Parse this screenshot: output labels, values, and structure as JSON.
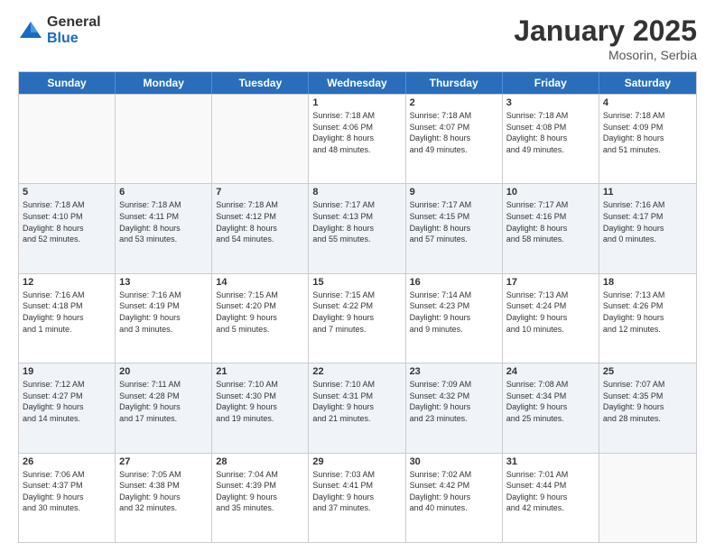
{
  "logo": {
    "general": "General",
    "blue": "Blue"
  },
  "title": {
    "month": "January 2025",
    "location": "Mosorin, Serbia"
  },
  "header_days": [
    "Sunday",
    "Monday",
    "Tuesday",
    "Wednesday",
    "Thursday",
    "Friday",
    "Saturday"
  ],
  "weeks": [
    [
      {
        "day": "",
        "text": ""
      },
      {
        "day": "",
        "text": ""
      },
      {
        "day": "",
        "text": ""
      },
      {
        "day": "1",
        "text": "Sunrise: 7:18 AM\nSunset: 4:06 PM\nDaylight: 8 hours\nand 48 minutes."
      },
      {
        "day": "2",
        "text": "Sunrise: 7:18 AM\nSunset: 4:07 PM\nDaylight: 8 hours\nand 49 minutes."
      },
      {
        "day": "3",
        "text": "Sunrise: 7:18 AM\nSunset: 4:08 PM\nDaylight: 8 hours\nand 49 minutes."
      },
      {
        "day": "4",
        "text": "Sunrise: 7:18 AM\nSunset: 4:09 PM\nDaylight: 8 hours\nand 51 minutes."
      }
    ],
    [
      {
        "day": "5",
        "text": "Sunrise: 7:18 AM\nSunset: 4:10 PM\nDaylight: 8 hours\nand 52 minutes."
      },
      {
        "day": "6",
        "text": "Sunrise: 7:18 AM\nSunset: 4:11 PM\nDaylight: 8 hours\nand 53 minutes."
      },
      {
        "day": "7",
        "text": "Sunrise: 7:18 AM\nSunset: 4:12 PM\nDaylight: 8 hours\nand 54 minutes."
      },
      {
        "day": "8",
        "text": "Sunrise: 7:17 AM\nSunset: 4:13 PM\nDaylight: 8 hours\nand 55 minutes."
      },
      {
        "day": "9",
        "text": "Sunrise: 7:17 AM\nSunset: 4:15 PM\nDaylight: 8 hours\nand 57 minutes."
      },
      {
        "day": "10",
        "text": "Sunrise: 7:17 AM\nSunset: 4:16 PM\nDaylight: 8 hours\nand 58 minutes."
      },
      {
        "day": "11",
        "text": "Sunrise: 7:16 AM\nSunset: 4:17 PM\nDaylight: 9 hours\nand 0 minutes."
      }
    ],
    [
      {
        "day": "12",
        "text": "Sunrise: 7:16 AM\nSunset: 4:18 PM\nDaylight: 9 hours\nand 1 minute."
      },
      {
        "day": "13",
        "text": "Sunrise: 7:16 AM\nSunset: 4:19 PM\nDaylight: 9 hours\nand 3 minutes."
      },
      {
        "day": "14",
        "text": "Sunrise: 7:15 AM\nSunset: 4:20 PM\nDaylight: 9 hours\nand 5 minutes."
      },
      {
        "day": "15",
        "text": "Sunrise: 7:15 AM\nSunset: 4:22 PM\nDaylight: 9 hours\nand 7 minutes."
      },
      {
        "day": "16",
        "text": "Sunrise: 7:14 AM\nSunset: 4:23 PM\nDaylight: 9 hours\nand 9 minutes."
      },
      {
        "day": "17",
        "text": "Sunrise: 7:13 AM\nSunset: 4:24 PM\nDaylight: 9 hours\nand 10 minutes."
      },
      {
        "day": "18",
        "text": "Sunrise: 7:13 AM\nSunset: 4:26 PM\nDaylight: 9 hours\nand 12 minutes."
      }
    ],
    [
      {
        "day": "19",
        "text": "Sunrise: 7:12 AM\nSunset: 4:27 PM\nDaylight: 9 hours\nand 14 minutes."
      },
      {
        "day": "20",
        "text": "Sunrise: 7:11 AM\nSunset: 4:28 PM\nDaylight: 9 hours\nand 17 minutes."
      },
      {
        "day": "21",
        "text": "Sunrise: 7:10 AM\nSunset: 4:30 PM\nDaylight: 9 hours\nand 19 minutes."
      },
      {
        "day": "22",
        "text": "Sunrise: 7:10 AM\nSunset: 4:31 PM\nDaylight: 9 hours\nand 21 minutes."
      },
      {
        "day": "23",
        "text": "Sunrise: 7:09 AM\nSunset: 4:32 PM\nDaylight: 9 hours\nand 23 minutes."
      },
      {
        "day": "24",
        "text": "Sunrise: 7:08 AM\nSunset: 4:34 PM\nDaylight: 9 hours\nand 25 minutes."
      },
      {
        "day": "25",
        "text": "Sunrise: 7:07 AM\nSunset: 4:35 PM\nDaylight: 9 hours\nand 28 minutes."
      }
    ],
    [
      {
        "day": "26",
        "text": "Sunrise: 7:06 AM\nSunset: 4:37 PM\nDaylight: 9 hours\nand 30 minutes."
      },
      {
        "day": "27",
        "text": "Sunrise: 7:05 AM\nSunset: 4:38 PM\nDaylight: 9 hours\nand 32 minutes."
      },
      {
        "day": "28",
        "text": "Sunrise: 7:04 AM\nSunset: 4:39 PM\nDaylight: 9 hours\nand 35 minutes."
      },
      {
        "day": "29",
        "text": "Sunrise: 7:03 AM\nSunset: 4:41 PM\nDaylight: 9 hours\nand 37 minutes."
      },
      {
        "day": "30",
        "text": "Sunrise: 7:02 AM\nSunset: 4:42 PM\nDaylight: 9 hours\nand 40 minutes."
      },
      {
        "day": "31",
        "text": "Sunrise: 7:01 AM\nSunset: 4:44 PM\nDaylight: 9 hours\nand 42 minutes."
      },
      {
        "day": "",
        "text": ""
      }
    ]
  ]
}
